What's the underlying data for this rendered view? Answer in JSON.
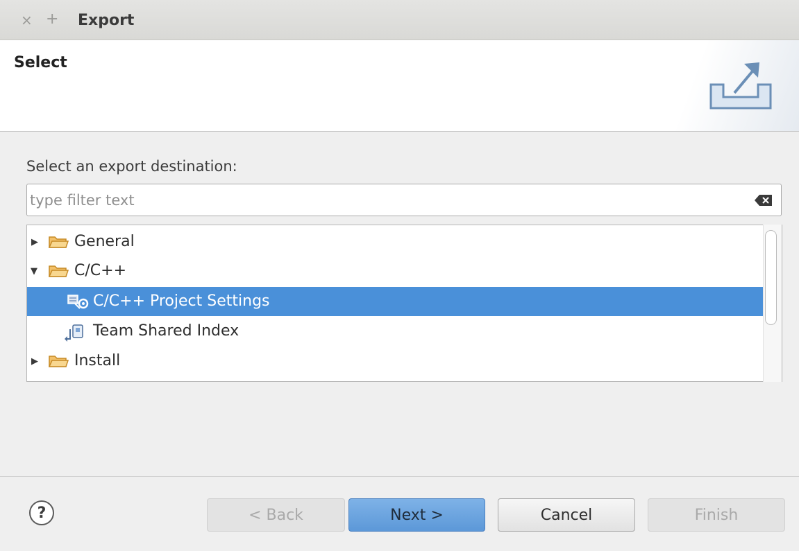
{
  "titlebar": {
    "close_icon": "close-icon",
    "add_icon": "add-icon",
    "close_glyph": "×",
    "add_glyph": "+",
    "title": "Export"
  },
  "banner": {
    "title": "Select",
    "icon": "export-icon"
  },
  "content": {
    "prompt": "Select an export destination:",
    "filter_placeholder": "type filter text",
    "filter_value": "",
    "clear_icon": "clear-icon"
  },
  "tree": {
    "items": [
      {
        "label": "General",
        "level": 0,
        "expanded": false,
        "icon": "folder-icon",
        "selected": false
      },
      {
        "label": "C/C++",
        "level": 0,
        "expanded": true,
        "icon": "folder-icon",
        "selected": false
      },
      {
        "label": "C/C++ Project Settings",
        "level": 1,
        "icon": "project-settings-icon",
        "selected": true
      },
      {
        "label": "Team Shared Index",
        "level": 1,
        "icon": "shared-index-icon",
        "selected": false
      },
      {
        "label": "Install",
        "level": 0,
        "expanded": false,
        "icon": "folder-icon",
        "selected": false
      }
    ]
  },
  "footer": {
    "help_glyph": "?",
    "back_label": "< Back",
    "next_label": "Next >",
    "cancel_label": "Cancel",
    "finish_label": "Finish"
  },
  "colors": {
    "selection": "#4a90d9",
    "primary_button": "#6aa3df",
    "folder": "#e8a33b"
  }
}
